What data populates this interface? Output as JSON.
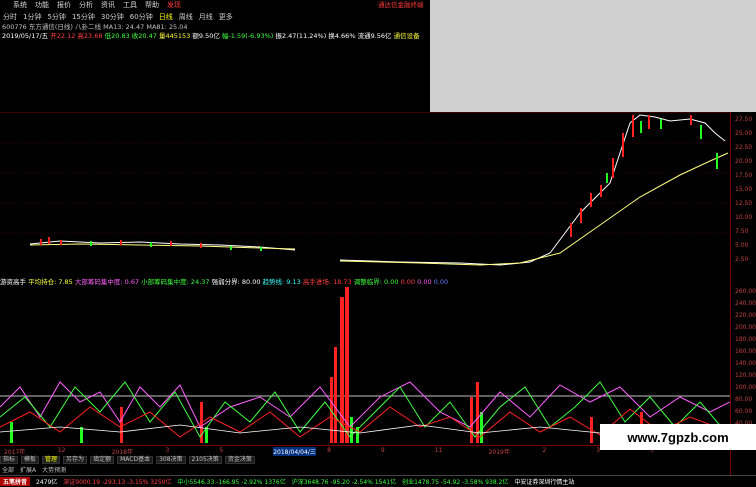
{
  "menu": {
    "items": [
      "系统",
      "功能",
      "报价",
      "分析",
      "资讯",
      "工具",
      "帮助",
      "发现"
    ],
    "right_text": "通达信金融终端"
  },
  "periods": {
    "items": [
      "分时",
      "1分钟",
      "5分钟",
      "15分钟",
      "30分钟",
      "60分钟",
      "日线",
      "周线",
      "月线",
      "更多"
    ],
    "active_index": 6
  },
  "info": {
    "line1": "600776 东方通信(日线) 八卦二线  MA13: 24.47  MA81: 25.04",
    "line2_date": "2019/05/17/五",
    "line2_open": "开22.12",
    "line2_high": "高23.68",
    "line2_low": "低20.83",
    "line2_close": "收20.47",
    "line2_vol": "量445153",
    "line2_amt": "额9.50亿",
    "line2_chg": "幅-1.59(-6.93%)",
    "line2_amp": "振2.47(11.24%)",
    "line2_turn": "换4.66%",
    "line2_float": "流通9.56亿",
    "line2_sector": "通信设备"
  },
  "indicator": {
    "name": "游资高手",
    "items": [
      {
        "label": "平均持仓: 7.85",
        "color": "#ffff40"
      },
      {
        "label": "大部筹码集中度: 0.67",
        "color": "#ff60ff"
      },
      {
        "label": "小部筹码集中度: 24.37",
        "color": "#40ff40"
      },
      {
        "label": "强弱分界: 80.00",
        "color": "#ffffff"
      },
      {
        "label": "趋势线: 9.13",
        "color": "#40ffff"
      },
      {
        "label": "高手进场: 18.73",
        "color": "#ff4040"
      },
      {
        "label": "调整临界: 0.00",
        "color": "#40ff40"
      },
      {
        "label": "0.00",
        "color": "#ff4040"
      },
      {
        "label": "0.00",
        "color": "#ff60ff"
      },
      {
        "label": "0.00",
        "color": "#6080ff"
      }
    ]
  },
  "price_axis": [
    "27.50",
    "25.00",
    "22.50",
    "20.00",
    "17.50",
    "15.00",
    "12.50",
    "10.00",
    "7.50",
    "5.00",
    "2.50"
  ],
  "ind_axis": [
    "260.00",
    "240.00",
    "220.00",
    "200.00",
    "180.00",
    "160.00",
    "140.00",
    "120.00",
    "100.00",
    "80.00",
    "60.00",
    "40.00",
    "20.00"
  ],
  "xaxis": {
    "labels": [
      "2017年",
      "12",
      "2018年",
      "3",
      "5",
      "2018/04/04/三",
      "8",
      "9",
      "11",
      "2019年",
      "2",
      "3",
      "5"
    ]
  },
  "tabs": [
    "指标",
    "模板",
    "管理",
    "另存为",
    "填定额",
    "MACD基本",
    "308决策",
    "2105决策",
    "资金决策"
  ],
  "tabs_selected": 2,
  "row2": [
    "全部",
    "扩展A",
    "大势预测"
  ],
  "status": {
    "logo": "五笔拼音",
    "items": [
      {
        "text": "2479亿",
        "color": "#ffffff"
      },
      {
        "text": "深证9000.19 -293.13 -3.15% 3250亿",
        "color": "#ff4040"
      },
      {
        "text": "中小5546.33 -166.95 -2.92% 1376亿",
        "color": "#40ff40"
      },
      {
        "text": "沪深3648.76 -95.20 -2.54% 1541亿",
        "color": "#40ff40"
      },
      {
        "text": "创业1478.75 -54.92 -3.58% 938.2亿",
        "color": "#40ff40"
      },
      {
        "text": "中安证券深圳行情主站",
        "color": "#ffffff"
      }
    ]
  },
  "watermark": "www.7gpzb.com",
  "colors": {
    "up": "#ff2020",
    "down": "#20ff20",
    "ma_short": "#ffffff",
    "ma_long": "#ffff80"
  }
}
